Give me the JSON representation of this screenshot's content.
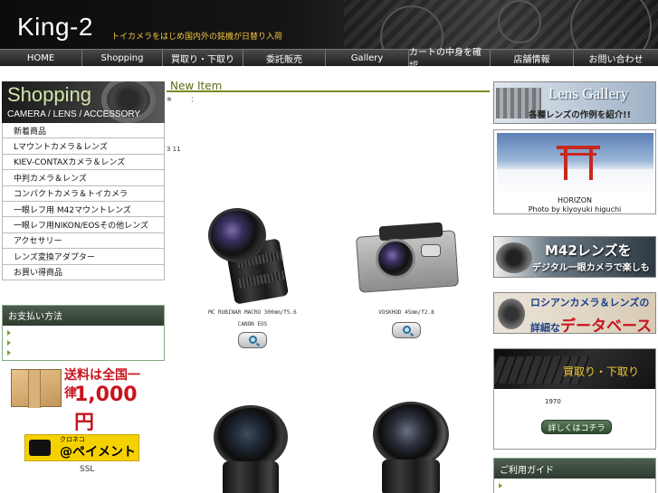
{
  "header": {
    "logo": "King-2",
    "tagline": "トイカメラをはじめ国内外の銘機が日替り入荷"
  },
  "nav": [
    {
      "label": "HOME"
    },
    {
      "label": "Shopping"
    },
    {
      "label": "買取り・下取り"
    },
    {
      "label": "委託販売"
    },
    {
      "label": "Gallery"
    },
    {
      "label": "カートの中身を確認"
    },
    {
      "label": "店舗情報"
    },
    {
      "label": "お問い合わせ"
    }
  ],
  "sidebar": {
    "shopping_title": "Shopping",
    "shopping_sub": "CAMERA / LENS / ACCESSORY",
    "categories": [
      {
        "label": "新着商品"
      },
      {
        "label": "Lマウントカメラ＆レンズ"
      },
      {
        "label": "KIEV-CONTAXカメラ＆レンズ"
      },
      {
        "label": "中判カメラ＆レンズ"
      },
      {
        "label": "コンパクトカメラ＆トイカメラ"
      },
      {
        "label": "一眼レフ用 M42マウントレンズ"
      },
      {
        "label": "一眼レフ用NIKON/EOSその他レンズ"
      },
      {
        "label": "アクセサリー"
      },
      {
        "label": "レンズ変換アダプター"
      },
      {
        "label": "お買い得商品"
      }
    ],
    "payment_title": "お支払い方法",
    "shipping_promo": "送料は全国一律",
    "shipping_price": "1,000円",
    "kuroneko_small": "クロネコ",
    "kuroneko_main": "@ペイメント",
    "ssl": "SSL"
  },
  "main": {
    "title": "New Item",
    "note": "※　　　：",
    "count": "3 11",
    "products": [
      {
        "name": "MC RUBINAR MACRO 300mm/f5.6",
        "name2": "CANON EOS"
      },
      {
        "name": "VOSKHOD 45mm/f2.8",
        "name2": ""
      }
    ]
  },
  "right": {
    "lens_gallery_title": "Lens Gallery",
    "lens_gallery_sub": "各種レンズの作例を紹介!!",
    "horizon_title": "HORIZON",
    "horizon_credit": "Photo by kiyoyuki higuchi",
    "m42_line1": "M42レンズを",
    "m42_line2": "デジタル一眼カメラで楽しもう!!",
    "rus_line1": "ロシアンカメラ＆レンズの",
    "rus_line2a": "詳細な",
    "rus_line2b": "データベース",
    "buy_title": "買取り・下取り",
    "buy_note": "1970",
    "detail_button": "詳しくはコチラ",
    "guide_title": "ご利用ガイド"
  }
}
